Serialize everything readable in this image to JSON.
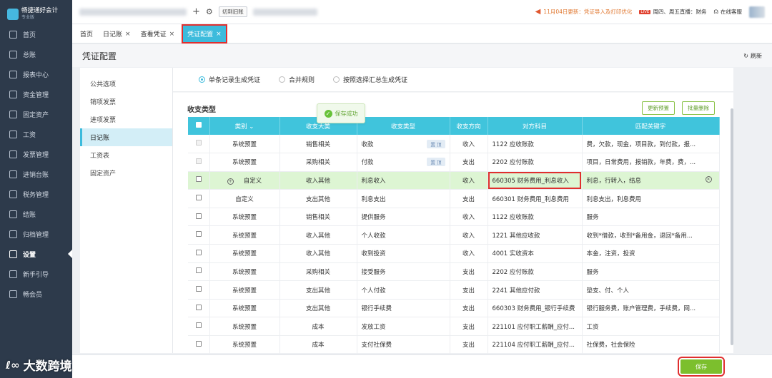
{
  "app": {
    "name": "畅捷通好会计",
    "edition": "专业版"
  },
  "sidebar": {
    "items": [
      {
        "label": "首页",
        "icon": "home-icon"
      },
      {
        "label": "总账",
        "icon": "ledger-icon"
      },
      {
        "label": "报表中心",
        "icon": "chart-icon"
      },
      {
        "label": "资金管理",
        "icon": "money-icon"
      },
      {
        "label": "固定资产",
        "icon": "asset-icon"
      },
      {
        "label": "工资",
        "icon": "salary-icon"
      },
      {
        "label": "发票管理",
        "icon": "invoice-icon"
      },
      {
        "label": "进销台账",
        "icon": "inventory-icon"
      },
      {
        "label": "税务管理",
        "icon": "tax-icon"
      },
      {
        "label": "结账",
        "icon": "close-book-icon"
      },
      {
        "label": "归档管理",
        "icon": "archive-icon"
      },
      {
        "label": "设置",
        "icon": "gear-icon"
      },
      {
        "label": "新手引导",
        "icon": "guide-icon"
      },
      {
        "label": "畅会员",
        "icon": "vip-icon"
      }
    ]
  },
  "topbar": {
    "switch_label": "切到旧账",
    "announcement": "11月04日更新：凭证导入及打印优化",
    "live_badge": "LIVE",
    "live_text": "周四、周五直播：财务",
    "service": "在线客服"
  },
  "tabs": [
    {
      "label": "首页",
      "closable": false
    },
    {
      "label": "日记账",
      "closable": true
    },
    {
      "label": "查看凭证",
      "closable": true
    },
    {
      "label": "凭证配置",
      "closable": true
    }
  ],
  "page": {
    "title": "凭证配置",
    "refresh": "刷新"
  },
  "settings_nav": [
    "公共选项",
    "销项发票",
    "进项发票",
    "日记账",
    "工资表",
    "固定资产"
  ],
  "radios": [
    "单条记录生成凭证",
    "合并规则",
    "按照选择汇总生成凭证"
  ],
  "section_title": "收支类型",
  "buttons": {
    "update_preset": "更新预置",
    "batch_delete": "批量删除",
    "save": "保存"
  },
  "toast": "保存成功",
  "table": {
    "headers": [
      "类别",
      "收支大类",
      "收支类型",
      "收支方向",
      "对方科目",
      "匹配关键字"
    ],
    "pin_label": "置 顶",
    "rows": [
      {
        "category": "系统预置",
        "major": "销售相关",
        "type": "收款",
        "direction": "收入",
        "account": "1122 应收账款",
        "keywords": "费，欠款，现金，项目款，到付款，报..."
      },
      {
        "category": "系统预置",
        "major": "采购相关",
        "type": "付款",
        "direction": "支出",
        "account": "2202 应付账款",
        "keywords": "项目，日常费用，报销款，年费，费，..."
      },
      {
        "category": "自定义",
        "major": "收入其他",
        "type": "利息收入",
        "direction": "收入",
        "account": "660305 财务费用_利息收入",
        "keywords": "利息，行转入，结息"
      },
      {
        "category": "自定义",
        "major": "支出其他",
        "type": "利息支出",
        "direction": "支出",
        "account": "660301 财务费用_利息费用",
        "keywords": "利息支出，利息费用"
      },
      {
        "category": "系统预置",
        "major": "销售相关",
        "type": "提供服务",
        "direction": "收入",
        "account": "1122 应收账款",
        "keywords": "服务"
      },
      {
        "category": "系统预置",
        "major": "收入其他",
        "type": "个人收款",
        "direction": "收入",
        "account": "1221 其他应收款",
        "keywords": "收到*借款，收到*备用金，退回*备用..."
      },
      {
        "category": "系统预置",
        "major": "收入其他",
        "type": "收到投资",
        "direction": "收入",
        "account": "4001 实收资本",
        "keywords": "本金，注资，投资"
      },
      {
        "category": "系统预置",
        "major": "采购相关",
        "type": "接受服务",
        "direction": "支出",
        "account": "2202 应付账款",
        "keywords": "服务"
      },
      {
        "category": "系统预置",
        "major": "支出其他",
        "type": "个人付款",
        "direction": "支出",
        "account": "2241 其他应付款",
        "keywords": "垫支、付、个人"
      },
      {
        "category": "系统预置",
        "major": "支出其他",
        "type": "银行手续费",
        "direction": "支出",
        "account": "660303 财务费用_银行手续费",
        "keywords": "银行服务费，账户管理费，手续费，网..."
      },
      {
        "category": "系统预置",
        "major": "成本",
        "type": "发放工资",
        "direction": "支出",
        "account": "221101 应付职工薪酬_应付...",
        "keywords": "工资"
      },
      {
        "category": "系统预置",
        "major": "成本",
        "type": "支付社保费",
        "direction": "支出",
        "account": "221104 应付职工薪酬_应付...",
        "keywords": "社保费，社会保险"
      }
    ]
  },
  "watermark": "大数跨境",
  "colors": {
    "accent": "#40c4dc",
    "sidebar": "#2d3a4b",
    "save": "#7cbf2d",
    "highlight": "#ddf5d3",
    "alert": "#e02f2f"
  }
}
